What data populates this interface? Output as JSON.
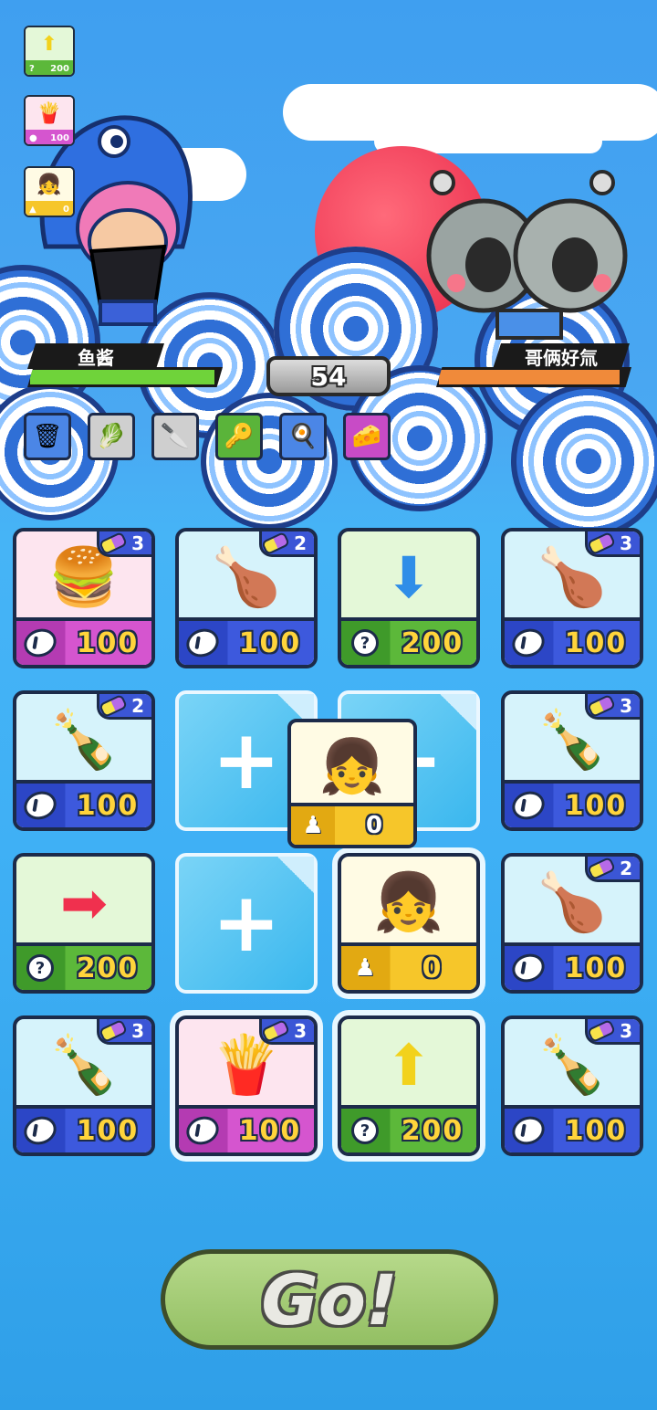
{
  "player": {
    "name": "鱼酱",
    "hp_fraction": 0.97
  },
  "enemy": {
    "name": "哥俩好氚",
    "hp_fraction": 0.95
  },
  "timer": "54",
  "inventory": [
    "trash-bin-icon",
    "leek-icon",
    "cleaver-icon",
    "key-icon",
    "frying-pan-icon",
    "cheese-icon"
  ],
  "sidebar_cards": [
    {
      "icon": "up-arrow-icon",
      "cost_icon": "question-icon",
      "cost": "200",
      "theme": "green"
    },
    {
      "icon": "fries-icon",
      "cost_icon": "egg-icon",
      "cost": "100",
      "theme": "pink"
    },
    {
      "icon": "girl-avatar-icon",
      "cost_icon": "person-icon",
      "cost": "0",
      "theme": "yellow"
    }
  ],
  "grid": [
    {
      "kind": "item",
      "icon": "burger-icon",
      "glyph": "🍔",
      "theme": "pink",
      "level": "3",
      "cost_icon": "egg",
      "cost": "100"
    },
    {
      "kind": "item",
      "icon": "drumstick-icon",
      "glyph": "🍗",
      "theme": "blue",
      "level": "2",
      "cost_icon": "egg",
      "cost": "100"
    },
    {
      "kind": "item",
      "icon": "down-arrow-icon",
      "glyph": "⬇",
      "theme": "green",
      "level": "",
      "cost_icon": "q",
      "cost": "200"
    },
    {
      "kind": "item",
      "icon": "drumstick-icon",
      "glyph": "🍗",
      "theme": "blue",
      "level": "3",
      "cost_icon": "egg",
      "cost": "100"
    },
    {
      "kind": "item",
      "icon": "cola-bottle-icon",
      "glyph": "🍾",
      "theme": "blue",
      "level": "2",
      "cost_icon": "egg",
      "cost": "100"
    },
    {
      "kind": "empty"
    },
    {
      "kind": "empty"
    },
    {
      "kind": "item",
      "icon": "cola-bottle-icon",
      "glyph": "🍾",
      "theme": "blue",
      "level": "3",
      "cost_icon": "egg",
      "cost": "100"
    },
    {
      "kind": "item",
      "icon": "right-arrow-icon",
      "glyph": "➡",
      "theme": "green",
      "level": "",
      "cost_icon": "q",
      "cost": "200"
    },
    {
      "kind": "empty"
    },
    {
      "kind": "item",
      "icon": "girl-avatar-icon",
      "glyph": "👧",
      "theme": "yellow",
      "level": "",
      "cost_icon": "person",
      "cost": "0",
      "selected": true
    },
    {
      "kind": "item",
      "icon": "drumstick-icon",
      "glyph": "🍗",
      "theme": "blue",
      "level": "2",
      "cost_icon": "egg",
      "cost": "100"
    },
    {
      "kind": "item",
      "icon": "cola-bottle-icon",
      "glyph": "🍾",
      "theme": "blue",
      "level": "3",
      "cost_icon": "egg",
      "cost": "100"
    },
    {
      "kind": "item",
      "icon": "fries-icon",
      "glyph": "🍟",
      "theme": "pink",
      "level": "3",
      "cost_icon": "egg",
      "cost": "100",
      "selected": true
    },
    {
      "kind": "item",
      "icon": "up-arrow-icon",
      "glyph": "⬆",
      "theme": "green",
      "level": "",
      "cost_icon": "q",
      "cost": "200",
      "selected": true
    },
    {
      "kind": "item",
      "icon": "cola-bottle-icon",
      "glyph": "🍾",
      "theme": "blue",
      "level": "3",
      "cost_icon": "egg",
      "cost": "100"
    }
  ],
  "dragging_card": {
    "icon": "girl-avatar-icon",
    "glyph": "👧",
    "cost": "0"
  },
  "go_label": "Go!",
  "colors": {
    "player_hp": "#6fd33a",
    "enemy_hp": "#f08a3a",
    "accent_blue": "#3b56d6"
  }
}
